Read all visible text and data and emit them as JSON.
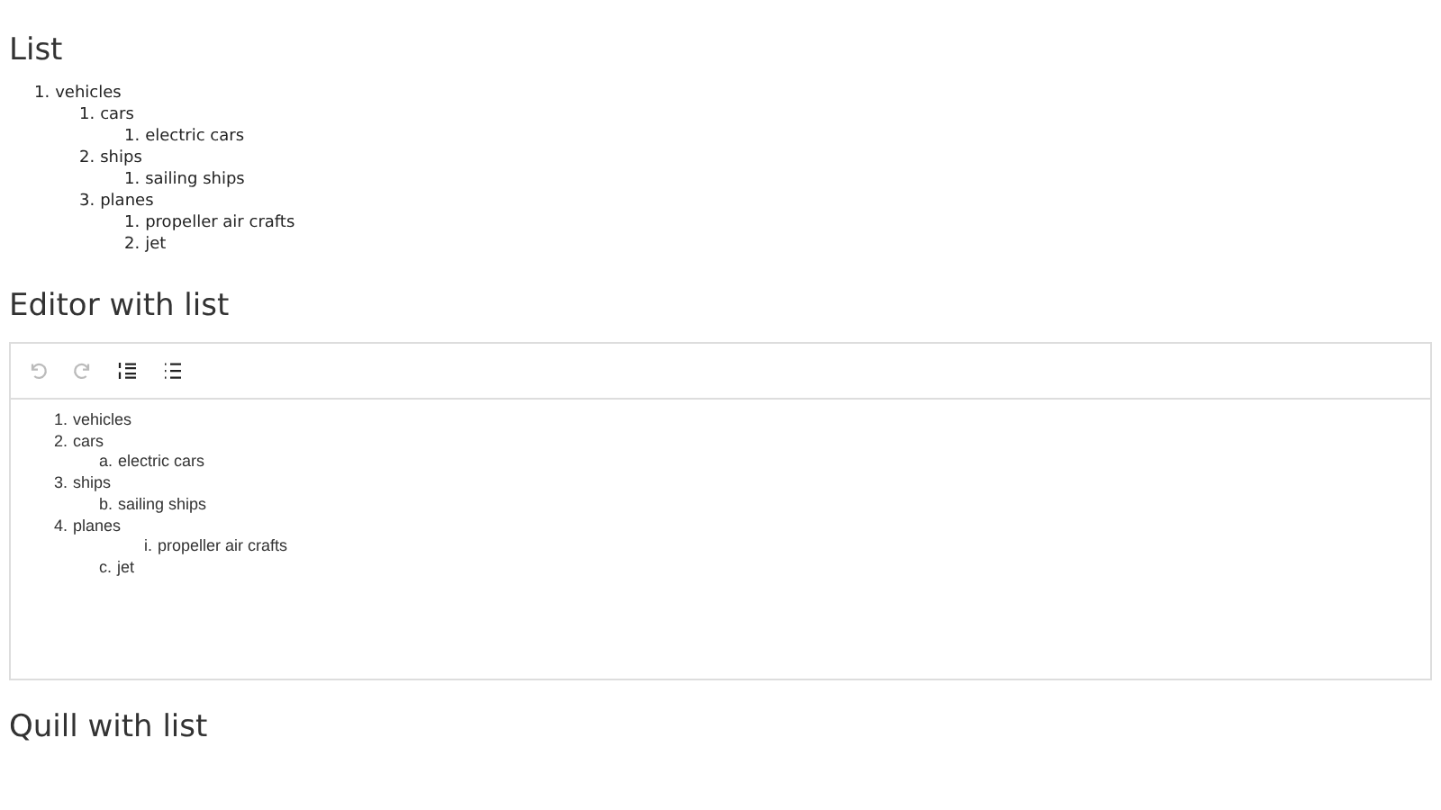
{
  "sections": [
    {
      "heading": "List",
      "kind": "list",
      "items": [
        {
          "marker": "1.",
          "text": "vehicles",
          "children": [
            {
              "marker": "1.",
              "text": "cars",
              "children": [
                {
                  "marker": "1.",
                  "text": "electric cars"
                }
              ]
            },
            {
              "marker": "2.",
              "text": "ships",
              "children": [
                {
                  "marker": "1.",
                  "text": "sailing ships"
                }
              ]
            },
            {
              "marker": "3.",
              "text": "planes",
              "children": [
                {
                  "marker": "1.",
                  "text": "propeller air crafts"
                },
                {
                  "marker": "2.",
                  "text": "jet"
                }
              ]
            }
          ]
        }
      ]
    },
    {
      "heading": "Editor with list",
      "kind": "editor",
      "toolbar": [
        {
          "kind": "undo",
          "disabled": true
        },
        {
          "kind": "redo",
          "disabled": true
        },
        {
          "kind": "ordered",
          "disabled": false
        },
        {
          "kind": "bullet",
          "disabled": false
        }
      ],
      "items": [
        {
          "marker": "1.",
          "text": "vehicles"
        },
        {
          "marker": "2.",
          "text": "cars",
          "children": [
            {
              "marker": "a.",
              "text": "electric cars"
            }
          ]
        },
        {
          "marker": "3.",
          "text": "ships",
          "children": [
            {
              "marker": "b.",
              "text": "sailing ships"
            }
          ]
        },
        {
          "marker": "4.",
          "text": "planes",
          "children": [
            {
              "children": [
                {
                  "marker": "i.",
                  "text": "propeller air crafts"
                }
              ]
            },
            {
              "marker": "c.",
              "text": "jet"
            }
          ]
        }
      ]
    },
    {
      "heading": "Quill with list",
      "kind": "empty"
    }
  ]
}
